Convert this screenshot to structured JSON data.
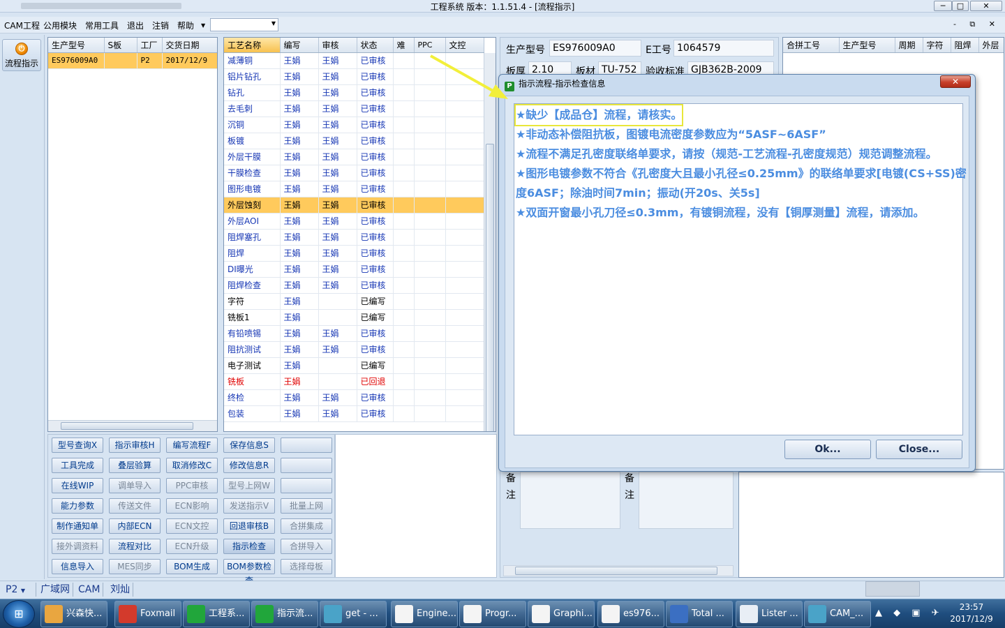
{
  "window": {
    "title": "工程系统   版本：1.1.51.4 - [流程指示]",
    "min": "─",
    "max": "□",
    "close": "✕"
  },
  "menu": {
    "items": [
      "CAM工程",
      "公用模块",
      "常用工具",
      "退出",
      "注销",
      "帮助"
    ],
    "mdi_buttons": "- ⧉ ✕"
  },
  "toolbar": {
    "flow_label": "流程指示"
  },
  "orders": {
    "columns": [
      "生产型号",
      "S板",
      "工厂",
      "交货日期"
    ],
    "rows": [
      [
        "ES976009A0",
        "",
        "P2",
        "2017/12/9"
      ]
    ]
  },
  "process": {
    "columns": [
      "工艺名称",
      "编写",
      "审核",
      "状态",
      "难",
      "PPC",
      "文控"
    ],
    "rows": [
      {
        "name": "减薄铜",
        "writer": "王娟",
        "reviewer": "王娟",
        "status": "已审核",
        "style": ""
      },
      {
        "name": "铝片钻孔",
        "writer": "王娟",
        "reviewer": "王娟",
        "status": "已审核",
        "style": ""
      },
      {
        "name": "钻孔",
        "writer": "王娟",
        "reviewer": "王娟",
        "status": "已审核",
        "style": ""
      },
      {
        "name": "去毛刺",
        "writer": "王娟",
        "reviewer": "王娟",
        "status": "已审核",
        "style": ""
      },
      {
        "name": "沉铜",
        "writer": "王娟",
        "reviewer": "王娟",
        "status": "已审核",
        "style": ""
      },
      {
        "name": "板镀",
        "writer": "王娟",
        "reviewer": "王娟",
        "status": "已审核",
        "style": ""
      },
      {
        "name": "外层干膜",
        "writer": "王娟",
        "reviewer": "王娟",
        "status": "已审核",
        "style": ""
      },
      {
        "name": "干膜检查",
        "writer": "王娟",
        "reviewer": "王娟",
        "status": "已审核",
        "style": ""
      },
      {
        "name": "图形电镀",
        "writer": "王娟",
        "reviewer": "王娟",
        "status": "已审核",
        "style": ""
      },
      {
        "name": "外层蚀刻",
        "writer": "王娟",
        "reviewer": "王娟",
        "status": "已审核",
        "style": "sel"
      },
      {
        "name": "外层AOI",
        "writer": "王娟",
        "reviewer": "王娟",
        "status": "已审核",
        "style": ""
      },
      {
        "name": "阻焊塞孔",
        "writer": "王娟",
        "reviewer": "王娟",
        "status": "已审核",
        "style": ""
      },
      {
        "name": "阻焊",
        "writer": "王娟",
        "reviewer": "王娟",
        "status": "已审核",
        "style": ""
      },
      {
        "name": "DI曝光",
        "writer": "王娟",
        "reviewer": "王娟",
        "status": "已审核",
        "style": ""
      },
      {
        "name": "阻焊检查",
        "writer": "王娟",
        "reviewer": "王娟",
        "status": "已审核",
        "style": ""
      },
      {
        "name": "字符",
        "writer": "王娟",
        "reviewer": "",
        "status": "已编写",
        "style": "black"
      },
      {
        "name": "铣板1",
        "writer": "王娟",
        "reviewer": "",
        "status": "已编写",
        "style": "black"
      },
      {
        "name": "有铅喷锡",
        "writer": "王娟",
        "reviewer": "王娟",
        "status": "已审核",
        "style": ""
      },
      {
        "name": "阻抗测试",
        "writer": "王娟",
        "reviewer": "王娟",
        "status": "已审核",
        "style": ""
      },
      {
        "name": "电子测试",
        "writer": "王娟",
        "reviewer": "",
        "status": "已编写",
        "style": "black"
      },
      {
        "name": "铣板",
        "writer": "王娟",
        "reviewer": "",
        "status": "已回退",
        "style": "red"
      },
      {
        "name": "终检",
        "writer": "王娟",
        "reviewer": "王娟",
        "status": "已审核",
        "style": ""
      },
      {
        "name": "包装",
        "writer": "王娟",
        "reviewer": "王娟",
        "status": "已审核",
        "style": ""
      }
    ]
  },
  "buttons": [
    [
      "型号查询X",
      "指示审核H",
      "编写流程F",
      "保存信息S",
      ""
    ],
    [
      "工具完成",
      "叠层验算",
      "取消修改C",
      "修改信息R",
      ""
    ],
    [
      "在线WIP",
      "调单导入",
      "PPC审核",
      "型号上网W",
      ""
    ],
    [
      "能力参数",
      "传送文件",
      "ECN影响",
      "发送指示V",
      "批量上网"
    ],
    [
      "制作通知单",
      "内部ECN",
      "ECN文控",
      "回退审核B",
      "合拼集成"
    ],
    [
      "接外调资料",
      "流程对比",
      "ECN升级",
      "指示检查",
      "合拼导入"
    ],
    [
      "信息导入",
      "MES同步",
      "BOM生成",
      "BOM参数检查",
      "选择母板"
    ]
  ],
  "detail": {
    "model_label": "生产型号",
    "model_value": "ES976009A0",
    "eno_label": "E工号",
    "eno_value": "1064579",
    "thickness_label": "板厚",
    "thickness_value": "2.10",
    "material_label": "板材",
    "material_value": "TU-752",
    "standard_label": "验收标准",
    "standard_value": "GJB362B-2009",
    "memo_label_1": "备注",
    "memo_label_2": "备注"
  },
  "combined": {
    "columns": [
      "合拼工号",
      "生产型号",
      "周期",
      "字符",
      "阻焊",
      "外层"
    ]
  },
  "statusbar": {
    "factory": "P2",
    "segments": [
      "广域网",
      "CAM",
      "刘灿"
    ]
  },
  "taskbar": {
    "items": [
      {
        "label": "兴森快...",
        "color": "#e9a640"
      },
      {
        "label": "Foxmail",
        "color": "#d33a2c"
      },
      {
        "label": "工程系...",
        "color": "#21a63b"
      },
      {
        "label": "指示流...",
        "color": "#21a63b"
      },
      {
        "label": "get - ...",
        "color": "#4aa3c8"
      },
      {
        "label": "Engine...",
        "color": "#f4f4f4"
      },
      {
        "label": "Progr...",
        "color": "#f4f4f4"
      },
      {
        "label": "Graphi...",
        "color": "#f4f4f4"
      },
      {
        "label": "es976...",
        "color": "#f4f4f4"
      },
      {
        "label": "Total ...",
        "color": "#3b6fc2"
      },
      {
        "label": "Lister ...",
        "color": "#e8eef5"
      },
      {
        "label": "CAM_...",
        "color": "#4aa3c8"
      }
    ],
    "time": "23:57",
    "date": "2017/12/9"
  },
  "dialog": {
    "title": "指示流程-指示检查信息",
    "close": "✕",
    "messages": [
      "★缺少【成品仓】流程，请核实。",
      "★非动态补偿阻抗板，图镀电流密度参数应为“5ASF~6ASF”",
      "★流程不满足孔密度联络单要求，请按（规范-工艺流程-孔密度规范）规范调整流程。",
      "★图形电镀参数不符合《孔密度大且最小孔径≤0.25mm》的联络单要求[电镀(CS+SS)密",
      "度6ASF；除油时间7min；振动(开20s、关5s]",
      "★双面开窗最小孔刀径≤0.3mm，有镀铜流程，没有【铜厚测量】流程，请添加。"
    ],
    "ok_label": "Ok...",
    "close_label": "Close..."
  },
  "colors": {
    "selection": "#ffca5c",
    "message_text": "#4b8de0",
    "highlight_box": "#e8e63a",
    "rejected": "#e00000"
  }
}
